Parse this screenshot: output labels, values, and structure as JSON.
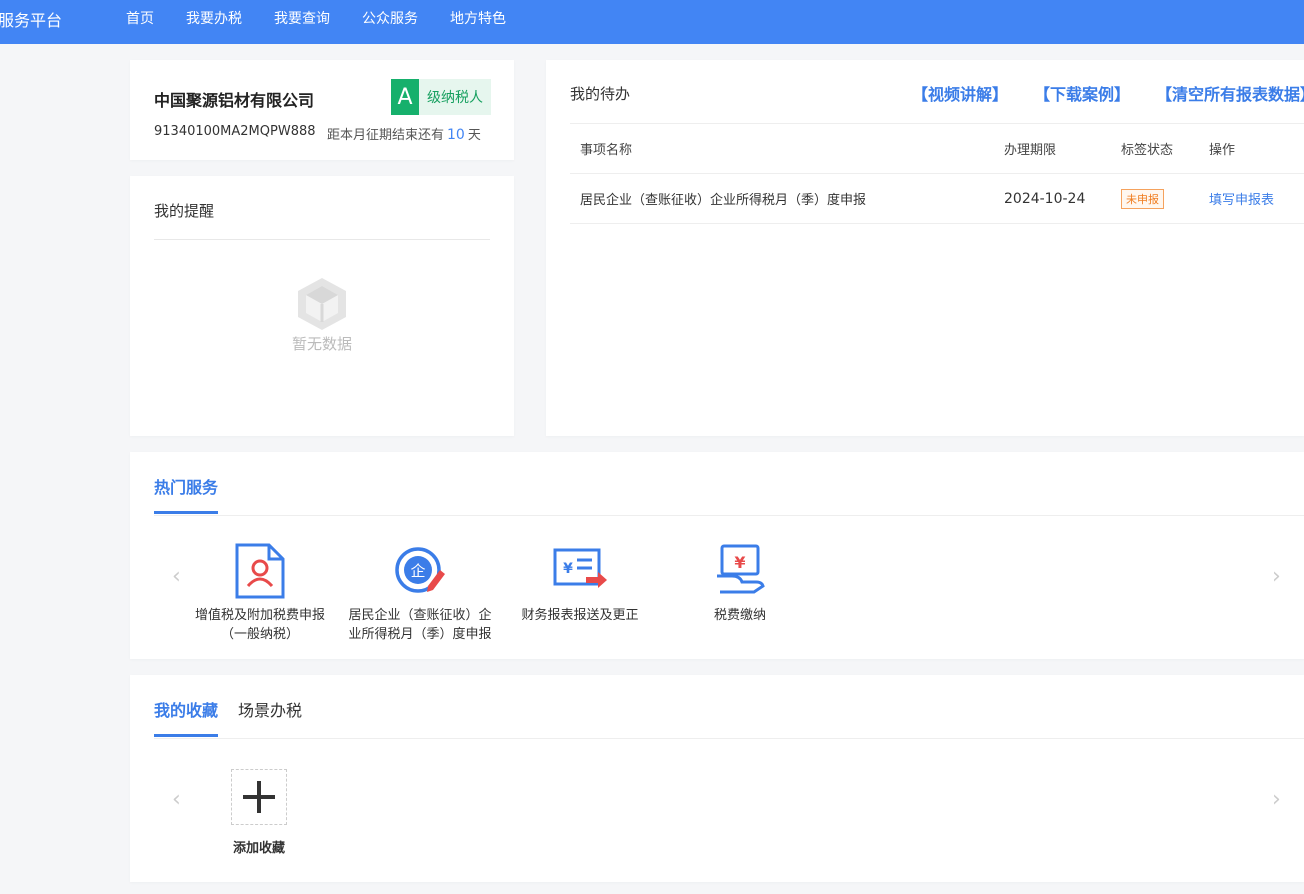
{
  "header": {
    "brand": "服务平台",
    "nav": [
      "首页",
      "我要办税",
      "我要查询",
      "公众服务",
      "地方特色"
    ]
  },
  "company": {
    "name": "中国聚源铝材有限公司",
    "grade_letter": "A",
    "grade_text": "级纳税人",
    "tax_id": "91340100MA2MQPW888",
    "deadline_prefix": "距本月征期结束还有",
    "days": "10",
    "deadline_suffix": "天"
  },
  "reminder": {
    "title": "我的提醒",
    "empty_text": "暂无数据"
  },
  "todo": {
    "title": "我的待办",
    "links": [
      "【视频讲解】",
      "【下载案例】",
      "【清空所有报表数据】"
    ],
    "columns": [
      "事项名称",
      "办理期限",
      "标签状态",
      "操作"
    ],
    "rows": [
      {
        "name": "居民企业（查账征收）企业所得税月（季）度申报",
        "deadline": "2024-10-24",
        "status": "未申报",
        "action": "填写申报表"
      }
    ]
  },
  "hot_services": {
    "title": "热门服务",
    "items": [
      {
        "line1": "增值税及附加税费申报",
        "line2": "（一般纳税）",
        "icon": "person-document-icon"
      },
      {
        "line1": "居民企业（查账征收）企",
        "line2": "业所得税月（季）度申报",
        "icon": "enterprise-edit-icon"
      },
      {
        "line1": "财务报表报送及更正",
        "line2": "",
        "icon": "finance-report-icon"
      },
      {
        "line1": "税费缴纳",
        "line2": "",
        "icon": "tax-payment-icon"
      }
    ]
  },
  "favorites": {
    "tabs": [
      "我的收藏",
      "场景办税"
    ],
    "add_label": "添加收藏"
  },
  "colors": {
    "primary": "#4285f4",
    "grade_green": "#16b06c",
    "warning_orange": "#f07c1e"
  }
}
